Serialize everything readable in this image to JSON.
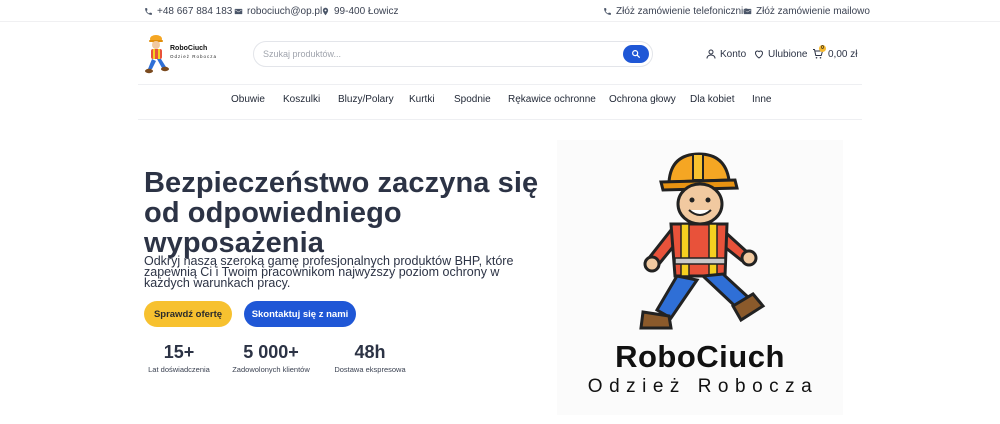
{
  "topbar": {
    "phone": "+48 667 884 183",
    "email": "robociuch@op.pl",
    "address": "99-400 Łowicz",
    "order_phone": "Złóż zamówienie telefonicznie",
    "order_email": "Złóż zamówienie mailowo"
  },
  "logo": {
    "name": "RoboCiuch",
    "tagline": "Odzież Robocza"
  },
  "search": {
    "placeholder": "Szukaj produktów..."
  },
  "header": {
    "account": "Konto",
    "favorites": "Ulubione",
    "cart_total": "0,00 zł",
    "cart_count": "0"
  },
  "nav": {
    "items": [
      {
        "label": "Obuwie"
      },
      {
        "label": "Koszulki"
      },
      {
        "label": "Bluzy/Polary"
      },
      {
        "label": "Kurtki"
      },
      {
        "label": "Spodnie"
      },
      {
        "label": "Rękawice ochronne"
      },
      {
        "label": "Ochrona głowy"
      },
      {
        "label": "Dla kobiet"
      },
      {
        "label": "Inne"
      }
    ]
  },
  "hero": {
    "title": "Bezpieczeństwo zaczyna się od odpowiedniego wyposażenia",
    "text": "Odkryj naszą szeroką gamę profesjonalnych produktów BHP, które zapewnią Ci i Twoim pracownikom najwyższy poziom ochrony w każdych warunkach pracy.",
    "cta_primary": "Sprawdź ofertę",
    "cta_secondary": "Skontaktuj się z nami"
  },
  "stats": [
    {
      "value": "15+",
      "label": "Lat doświadczenia"
    },
    {
      "value": "5 000+",
      "label": "Zadowolonych klientów"
    },
    {
      "value": "48h",
      "label": "Dostawa ekspresowa"
    }
  ],
  "hero_image": {
    "brand": "RoboCiuch",
    "tagline": "Odzież Robocza"
  },
  "colors": {
    "primary_blue": "#1f57d6",
    "accent_yellow": "#f7c12f",
    "text_dark": "#2c3345"
  },
  "icons": [
    "phone-icon",
    "mail-icon",
    "location-pin-icon",
    "search-icon",
    "user-icon",
    "heart-icon",
    "cart-icon"
  ]
}
